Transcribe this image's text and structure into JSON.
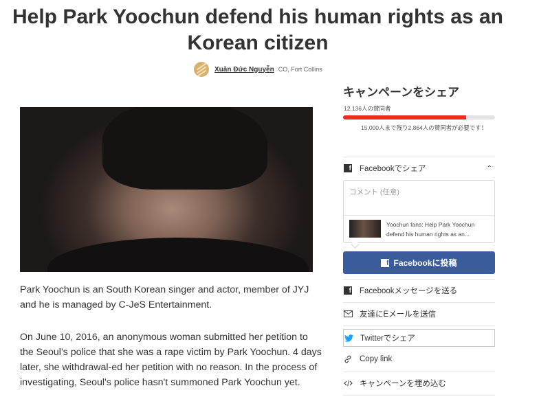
{
  "petition": {
    "title": "Help Park Yoochun defend his human rights as an Korean citizen",
    "author_name": "Xuân Đức Nguyễn",
    "author_location": "CO, Fort Collins",
    "paragraphs": [
      "Park Yoochun is an South Korean singer and actor, member of JYJ and he is managed by C-JeS Entertainment.",
      "On June 10, 2016, an anonymous woman submitted her petition to the Seoul's police that she was a rape victim by Park Yoochun. 4 days later, she withdrawal-ed her petition with no reason. In the process of investigating, Seoul's police hasn't summoned Park Yoochun yet."
    ]
  },
  "share": {
    "title": "キャンペーンをシェア",
    "supporters_text": "12,136人の賛同者",
    "progress_fraction": 0.81,
    "needed_text": "15,000人まで残り2,864人の賛同者が必要です！",
    "facebook_share_label": "Facebookでシェア",
    "comment_placeholder": "コメント (任意)",
    "preview_text": "Yoochun fans: Help Park Yoochun defend his human rights as an...",
    "post_button_label": "Facebookに投稿",
    "options": [
      {
        "label": "Facebookメッセージを送る",
        "icon": "facebook-icon"
      },
      {
        "label": "友達にEメールを送信",
        "icon": "mail-icon"
      },
      {
        "label": "Twitterでシェア",
        "icon": "twitter-icon"
      },
      {
        "label": "Copy link",
        "icon": "link-icon"
      },
      {
        "label": "キャンペーンを埋め込む",
        "icon": "code-icon"
      }
    ]
  },
  "colors": {
    "progress": "#ec2c22",
    "facebook_blue": "#3b5c9a",
    "twitter_blue": "#1da1f2"
  }
}
